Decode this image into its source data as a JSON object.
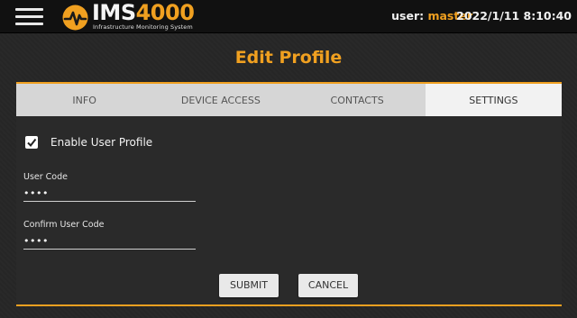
{
  "header": {
    "menu_icon": "hamburger-menu-icon",
    "logo_main_ims": "IMS",
    "logo_main_num": "4000",
    "logo_sub": "Infrastructure Monitoring System",
    "user_label": "user:",
    "user_name": "master",
    "datetime": "2022/1/11 8:10:40"
  },
  "page": {
    "title": "Edit Profile"
  },
  "tabs": [
    {
      "label": "INFO",
      "active": false
    },
    {
      "label": "DEVICE ACCESS",
      "active": false
    },
    {
      "label": "CONTACTS",
      "active": false
    },
    {
      "label": "SETTINGS",
      "active": true
    }
  ],
  "form": {
    "enable_label": "Enable User Profile",
    "enable_checked": true,
    "user_code_label": "User Code",
    "user_code_value": "••••",
    "confirm_code_label": "Confirm User Code",
    "confirm_code_value": "••••",
    "submit_label": "SUBMIT",
    "cancel_label": "CANCEL"
  },
  "colors": {
    "accent": "#f0a020",
    "background": "#262626",
    "topbar": "#111111",
    "tab_bar": "#d6d6d6"
  }
}
